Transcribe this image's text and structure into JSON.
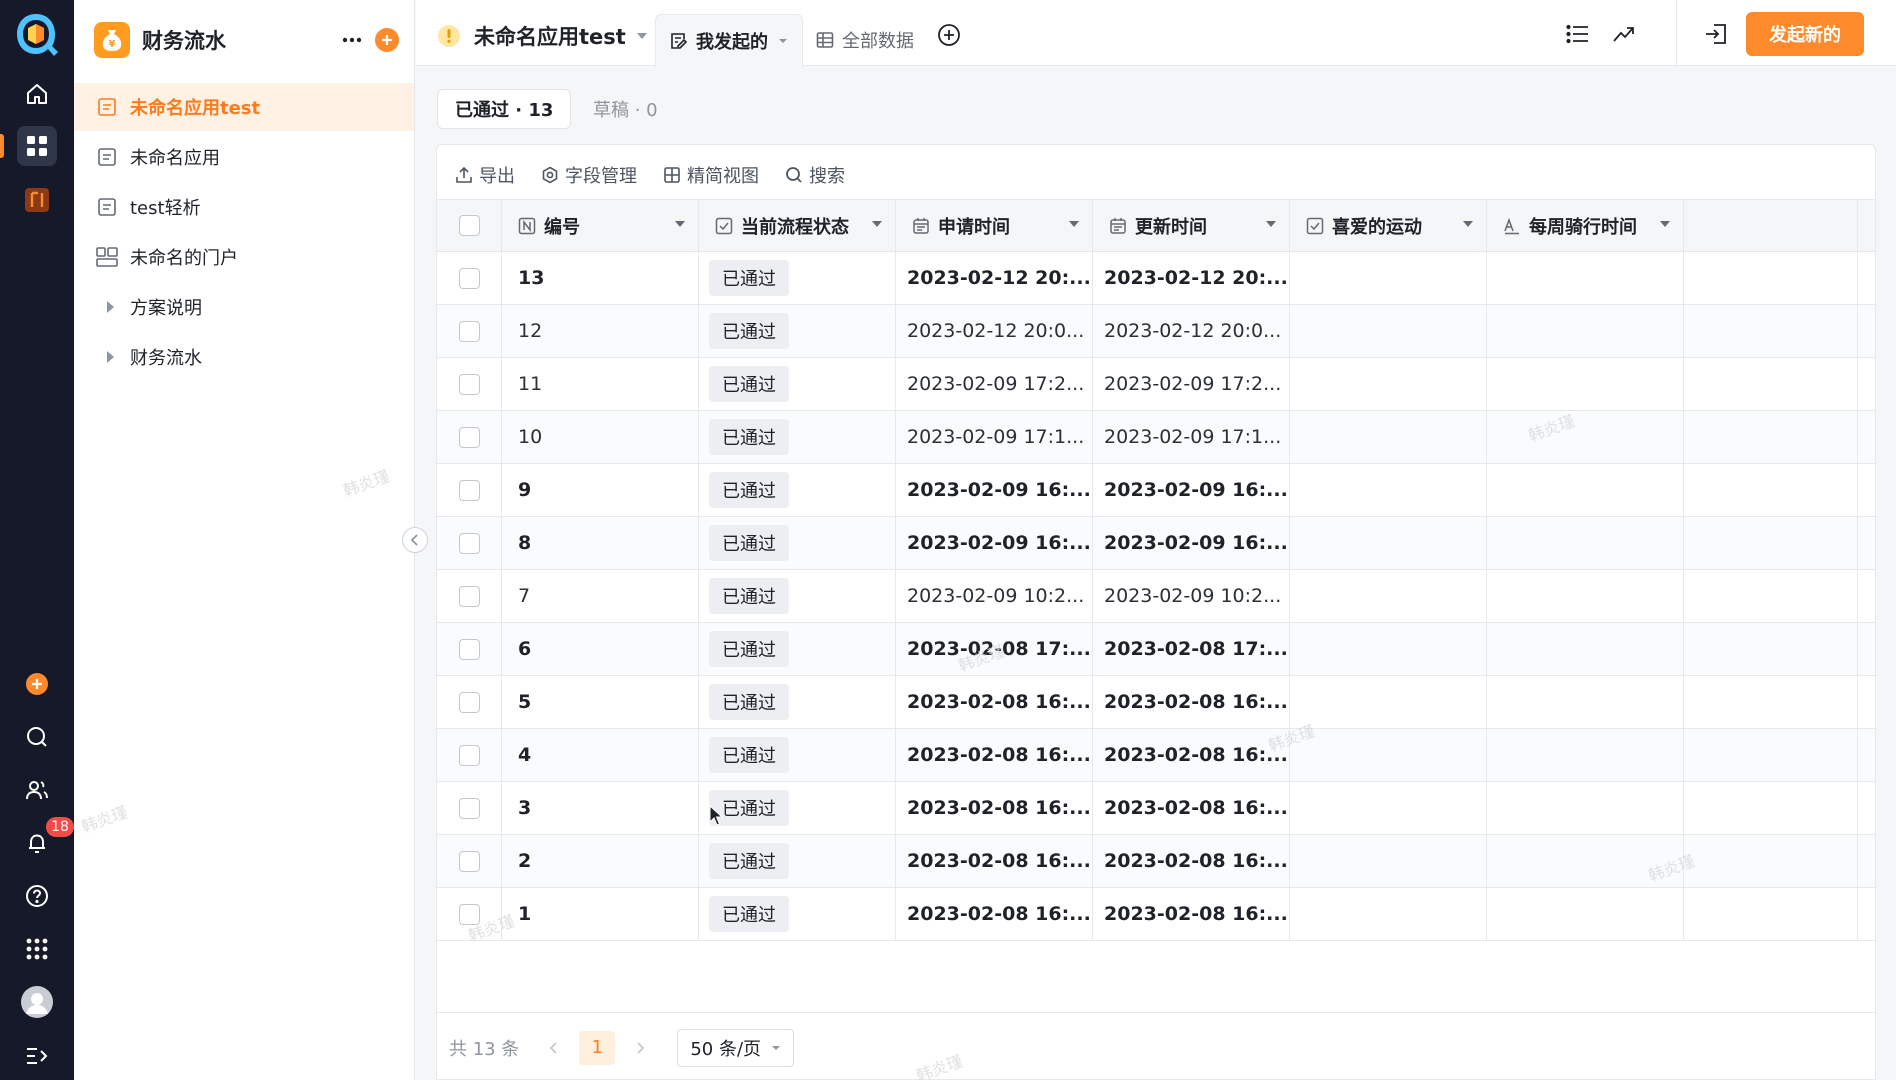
{
  "sidebar": {
    "title": "财务流水",
    "items": [
      {
        "label": "未命名应用test",
        "icon": "form-icon",
        "active": true
      },
      {
        "label": "未命名应用",
        "icon": "form-icon"
      },
      {
        "label": "test轻析",
        "icon": "form-icon"
      },
      {
        "label": "未命名的门户",
        "icon": "portal-icon"
      },
      {
        "label": "方案说明",
        "icon": "folder-caret-icon"
      },
      {
        "label": "财务流水",
        "icon": "folder-caret-icon"
      }
    ]
  },
  "rail": {
    "notification_count": "18"
  },
  "header": {
    "app_name": "未命名应用test",
    "tabs": [
      {
        "label": "我发起的",
        "active": true
      },
      {
        "label": "全部数据",
        "active": false
      }
    ],
    "primary_button": "发起新的"
  },
  "status_tabs": [
    {
      "label": "已通过 · 13",
      "active": true
    },
    {
      "label": "草稿 · 0",
      "active": false
    }
  ],
  "toolbar": {
    "export": "导出",
    "fields": "字段管理",
    "compact_view": "精简视图",
    "search": "搜索"
  },
  "table": {
    "columns": [
      {
        "label": "编号",
        "icon": "number-field-icon"
      },
      {
        "label": "当前流程状态",
        "icon": "checkbox-field-icon"
      },
      {
        "label": "申请时间",
        "icon": "calendar-field-icon"
      },
      {
        "label": "更新时间",
        "icon": "calendar-field-icon"
      },
      {
        "label": "喜爱的运动",
        "icon": "checkbox-field-icon"
      },
      {
        "label": "每周骑行时间",
        "icon": "text-field-icon"
      }
    ],
    "rows": [
      {
        "id": "13",
        "status": "已通过",
        "applied": "2023-02-12 20:...",
        "updated": "2023-02-12 20:...",
        "bold": true
      },
      {
        "id": "12",
        "status": "已通过",
        "applied": "2023-02-12 20:0...",
        "updated": "2023-02-12 20:0...",
        "bold": false
      },
      {
        "id": "11",
        "status": "已通过",
        "applied": "2023-02-09 17:2...",
        "updated": "2023-02-09 17:2...",
        "bold": false
      },
      {
        "id": "10",
        "status": "已通过",
        "applied": "2023-02-09 17:1...",
        "updated": "2023-02-09 17:1...",
        "bold": false
      },
      {
        "id": "9",
        "status": "已通过",
        "applied": "2023-02-09 16:...",
        "updated": "2023-02-09 16:...",
        "bold": true
      },
      {
        "id": "8",
        "status": "已通过",
        "applied": "2023-02-09 16:...",
        "updated": "2023-02-09 16:...",
        "bold": true
      },
      {
        "id": "7",
        "status": "已通过",
        "applied": "2023-02-09 10:2...",
        "updated": "2023-02-09 10:2...",
        "bold": false
      },
      {
        "id": "6",
        "status": "已通过",
        "applied": "2023-02-08 17:...",
        "updated": "2023-02-08 17:...",
        "bold": true
      },
      {
        "id": "5",
        "status": "已通过",
        "applied": "2023-02-08 16:...",
        "updated": "2023-02-08 16:...",
        "bold": true
      },
      {
        "id": "4",
        "status": "已通过",
        "applied": "2023-02-08 16:...",
        "updated": "2023-02-08 16:...",
        "bold": true
      },
      {
        "id": "3",
        "status": "已通过",
        "applied": "2023-02-08 16:...",
        "updated": "2023-02-08 16:...",
        "bold": true
      },
      {
        "id": "2",
        "status": "已通过",
        "applied": "2023-02-08 16:...",
        "updated": "2023-02-08 16:...",
        "bold": true
      },
      {
        "id": "1",
        "status": "已通过",
        "applied": "2023-02-08 16:...",
        "updated": "2023-02-08 16:...",
        "bold": true
      }
    ]
  },
  "pagination": {
    "total": "共 13 条",
    "current_page": "1",
    "page_size": "50 条/页"
  },
  "watermark": "韩炎瑾",
  "colors": {
    "accent": "#ff8a2b",
    "rail_bg": "#15192a",
    "active_item_bg": "#fff2e5"
  }
}
